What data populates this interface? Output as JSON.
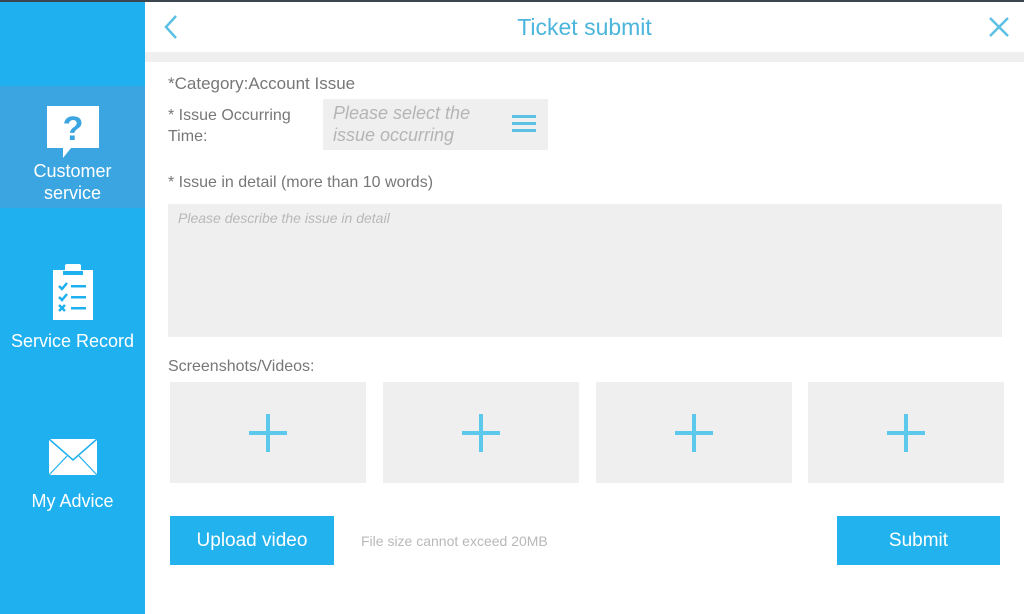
{
  "sidebar": {
    "items": [
      {
        "label": "Customer service",
        "icon": "question-bubble-icon",
        "active": true
      },
      {
        "label": "Service Record",
        "icon": "clipboard-checklist-icon",
        "active": false
      },
      {
        "label": "My Advice",
        "icon": "envelope-icon",
        "active": false
      }
    ]
  },
  "header": {
    "title": "Ticket submit",
    "back_icon": "chevron-left-icon",
    "close_icon": "close-icon"
  },
  "form": {
    "category_label": "*Category:",
    "category_value": "Account Issue",
    "time_label": "* Issue Occurring Time:",
    "time_placeholder": "Please select the issue occurring",
    "detail_label": "* Issue in detail (more than 10 words)",
    "detail_placeholder": "Please describe the issue in detail",
    "media_label": "Screenshots/Videos:",
    "media_slots": 4,
    "upload_button": "Upload video",
    "file_hint": "File size cannot exceed 20MB",
    "submit_button": "Submit"
  },
  "colors": {
    "accent": "#1fb0ef",
    "sidebar_active": "#3aa5e0",
    "title": "#4bb5dc",
    "field_bg": "#efefef"
  }
}
